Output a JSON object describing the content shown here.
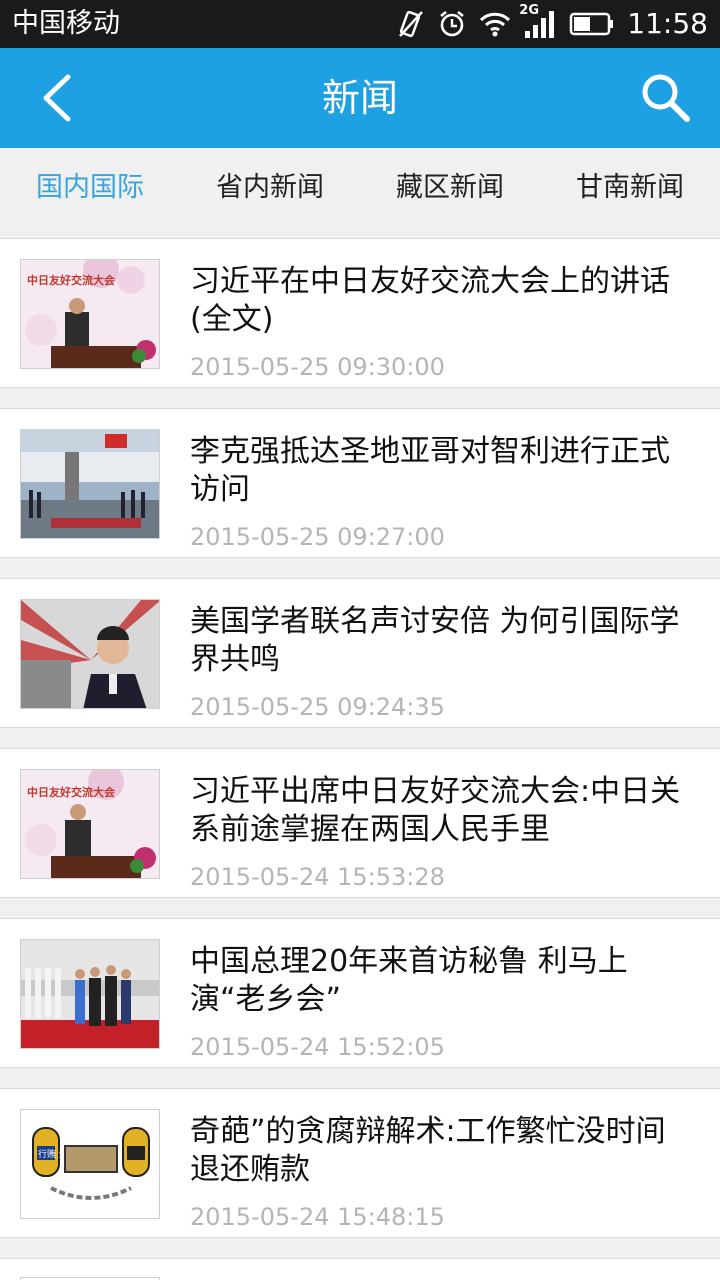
{
  "status_bar": {
    "carrier": "中国移动",
    "network": "2G",
    "time": "11:58",
    "icons": [
      "vibrate-icon",
      "alarm-icon",
      "wifi-icon",
      "signal-icon",
      "battery-icon"
    ]
  },
  "header": {
    "title": "新闻",
    "background": "#1ea1e3"
  },
  "tabs": [
    {
      "label": "国内国际",
      "active": true
    },
    {
      "label": "省内新闻",
      "active": false
    },
    {
      "label": "藏区新闻",
      "active": false
    },
    {
      "label": "甘南新闻",
      "active": false
    }
  ],
  "news": [
    {
      "title": "习近平在中日友好交流大会上的讲话(全文)",
      "date": "2015-05-25 09:30:00",
      "thumb_text": "中日友好交流大会"
    },
    {
      "title": "李克强抵达圣地亚哥对智利进行正式访问",
      "date": "2015-05-25 09:27:00",
      "thumb_text": ""
    },
    {
      "title": "美国学者联名声讨安倍 为何引国际学界共鸣",
      "date": "2015-05-25 09:24:35",
      "thumb_text": ""
    },
    {
      "title": "习近平出席中日友好交流大会:中日关系前途掌握在两国人民手里",
      "date": "2015-05-24 15:53:28",
      "thumb_text": "中日友好交流大会"
    },
    {
      "title": "中国总理20年来首访秘鲁 利马上演“老乡会”",
      "date": "2015-05-24 15:52:05",
      "thumb_text": ""
    },
    {
      "title": "奇葩”的贪腐辩解术:工作繁忙没时间退还贿款",
      "date": "2015-05-24 15:48:15",
      "thumb_text": "行贿 受贿"
    }
  ],
  "colors": {
    "accent": "#37a5dd",
    "date_text": "#b5b5b5"
  }
}
